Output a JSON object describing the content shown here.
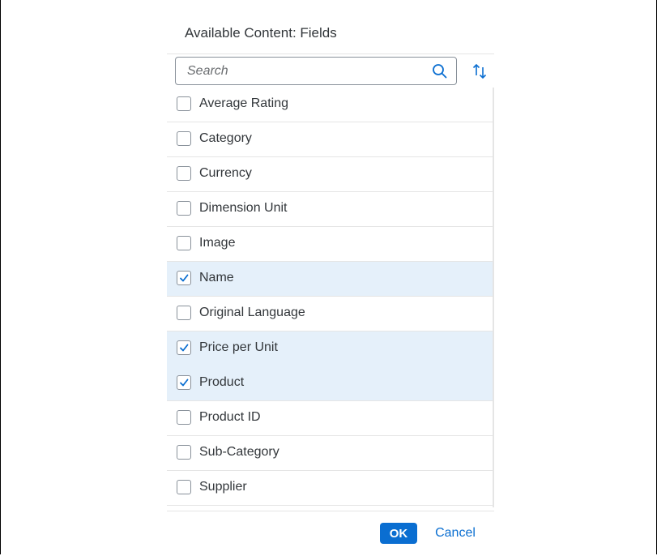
{
  "dialog": {
    "title": "Available Content: Fields",
    "search": {
      "placeholder": "Search",
      "value": "",
      "icon": "search-icon"
    },
    "sort_icon": "sort-ascending-descending-icon",
    "fields": [
      {
        "label": "Average Rating",
        "checked": false
      },
      {
        "label": "Category",
        "checked": false
      },
      {
        "label": "Currency",
        "checked": false
      },
      {
        "label": "Dimension Unit",
        "checked": false
      },
      {
        "label": "Image",
        "checked": false
      },
      {
        "label": "Name",
        "checked": true
      },
      {
        "label": "Original Language",
        "checked": false
      },
      {
        "label": "Price per Unit",
        "checked": true
      },
      {
        "label": "Product",
        "checked": true
      },
      {
        "label": "Product ID",
        "checked": false
      },
      {
        "label": "Sub-Category",
        "checked": false
      },
      {
        "label": "Supplier",
        "checked": false
      }
    ],
    "ok_label": "OK",
    "cancel_label": "Cancel"
  },
  "colors": {
    "accent": "#0a6ed1",
    "selected_row": "#e5f0fa",
    "text": "#32363a",
    "border": "#e5e5e5"
  }
}
